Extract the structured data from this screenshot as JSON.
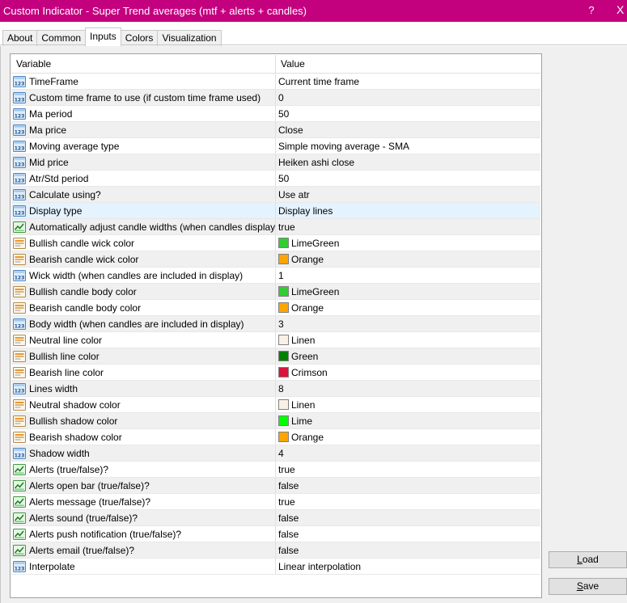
{
  "window": {
    "title": "Custom Indicator - Super Trend averages (mtf + alerts + candles)",
    "help": "?",
    "close": "X"
  },
  "tabs": [
    "About",
    "Common",
    "Inputs",
    "Colors",
    "Visualization"
  ],
  "active_tab": "Inputs",
  "grid": {
    "headers": {
      "variable": "Variable",
      "value": "Value"
    },
    "rows": [
      {
        "label": "TimeFrame",
        "value": "Current time frame",
        "icon": "number-icon"
      },
      {
        "label": "Custom time frame to use (if custom time frame used)",
        "value": "0",
        "icon": "number-icon"
      },
      {
        "label": "Ma period",
        "value": "50",
        "icon": "number-icon"
      },
      {
        "label": "Ma price",
        "value": "Close",
        "icon": "number-icon"
      },
      {
        "label": "Moving average type",
        "value": "Simple moving average - SMA",
        "icon": "number-icon"
      },
      {
        "label": "Mid price",
        "value": "Heiken ashi close",
        "icon": "number-icon"
      },
      {
        "label": "Atr/Std period",
        "value": "50",
        "icon": "number-icon"
      },
      {
        "label": "Calculate using?",
        "value": "Use atr",
        "icon": "number-icon"
      },
      {
        "label": "Display type",
        "value": "Display lines",
        "icon": "number-icon",
        "selected": true
      },
      {
        "label": "Automatically adjust candle widths (when candles displayed)?",
        "value": "true",
        "icon": "bool-icon"
      },
      {
        "label": "Bullish candle wick color",
        "value": "LimeGreen",
        "icon": "color-icon",
        "swatch": "#32cd32"
      },
      {
        "label": "Bearish candle wick color",
        "value": "Orange",
        "icon": "color-icon",
        "swatch": "#ffa500"
      },
      {
        "label": "Wick width (when candles are included in display)",
        "value": "1",
        "icon": "number-icon"
      },
      {
        "label": "Bullish candle body color",
        "value": "LimeGreen",
        "icon": "color-icon",
        "swatch": "#32cd32"
      },
      {
        "label": "Bearish candle body color",
        "value": "Orange",
        "icon": "color-icon",
        "swatch": "#ffa500"
      },
      {
        "label": "Body width (when candles are included in display)",
        "value": "3",
        "icon": "number-icon"
      },
      {
        "label": "Neutral line color",
        "value": "Linen",
        "icon": "color-icon",
        "swatch": "#faf0e6"
      },
      {
        "label": "Bullish line color",
        "value": "Green",
        "icon": "color-icon",
        "swatch": "#008000"
      },
      {
        "label": "Bearish line color",
        "value": "Crimson",
        "icon": "color-icon",
        "swatch": "#dc143c"
      },
      {
        "label": "Lines width",
        "value": "8",
        "icon": "number-icon"
      },
      {
        "label": "Neutral shadow color",
        "value": "Linen",
        "icon": "color-icon",
        "swatch": "#faf0e6"
      },
      {
        "label": "Bullish shadow color",
        "value": "Lime",
        "icon": "color-icon",
        "swatch": "#00ff00"
      },
      {
        "label": "Bearish shadow color",
        "value": "Orange",
        "icon": "color-icon",
        "swatch": "#ffa500"
      },
      {
        "label": "Shadow width",
        "value": "4",
        "icon": "number-icon"
      },
      {
        "label": "Alerts (true/false)?",
        "value": "true",
        "icon": "bool-icon"
      },
      {
        "label": "Alerts open bar (true/false)?",
        "value": "false",
        "icon": "bool-icon"
      },
      {
        "label": "Alerts message (true/false)?",
        "value": "true",
        "icon": "bool-icon"
      },
      {
        "label": "Alerts sound (true/false)?",
        "value": "false",
        "icon": "bool-icon"
      },
      {
        "label": "Alerts push notification (true/false)?",
        "value": "false",
        "icon": "bool-icon"
      },
      {
        "label": "Alerts email (true/false)?",
        "value": "false",
        "icon": "bool-icon"
      },
      {
        "label": "Interpolate",
        "value": "Linear interpolation",
        "icon": "number-icon"
      }
    ]
  },
  "buttons": {
    "load": {
      "mnemonic": "L",
      "rest": "oad"
    },
    "save": {
      "mnemonic": "S",
      "rest": "ave"
    }
  },
  "colors": {
    "titlebar": "#c3007e",
    "selected_row": "#e5f3ff"
  }
}
